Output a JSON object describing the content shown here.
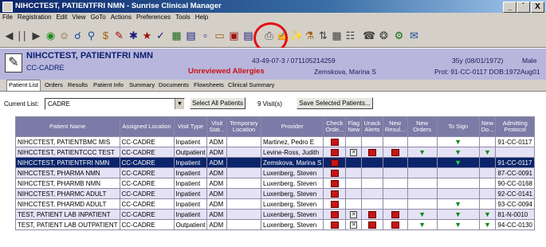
{
  "window": {
    "title": "NIHCCTEST, PATIENTFRI NMN - Sunrise Clinical Manager",
    "min": "_",
    "restore": "´",
    "close": "X"
  },
  "menu": [
    "File",
    "Registration",
    "Edit",
    "View",
    "GoTo",
    "Actions",
    "Preferences",
    "Tools",
    "Help"
  ],
  "toolbar_icons": [
    "back-icon",
    "forward-icon",
    "globe-icon",
    "search-icon",
    "magnifier-icon",
    "money-icon",
    "edit-icon",
    "star-icon",
    "person-icon",
    "check-icon",
    "grid-icon",
    "chart-icon",
    "doc-icon",
    "printer-icon",
    "pen-icon",
    "info-icon",
    "flask-icon",
    "sort-icon",
    "table-icon",
    "network-icon",
    "phone-icon",
    "pill-icon",
    "help-icon"
  ],
  "banner": {
    "patient_name": "NIHCCTEST, PATIENTFRI NMN",
    "location": "CC-CADRE",
    "id": "43-49-07-3 / 071105214259",
    "allergy": "Unreviewed Allergies",
    "provider": "Zemskova, Marina S",
    "age": "35y (08/01/1972)",
    "sex": "Male",
    "protocol": "Prot: 91-CC-0117   DOB:1972Aug01"
  },
  "tabs": [
    "Patient List",
    "Orders",
    "Results",
    "Patient Info",
    "Summary",
    "Documents",
    "Flowsheets",
    "Clinical Summary"
  ],
  "list": {
    "label": "Current List:",
    "value": "CADRE",
    "select_all": "Select All Patients",
    "visits": "9 Visit(s)",
    "save_selected": "Save Selected Patients..."
  },
  "table": {
    "headers": [
      "Patient Name",
      "Assigned Location",
      "Visit Type",
      "Visit Stat...",
      "Temporary Location",
      "Provider",
      "Check Orde...",
      "Flag New",
      "Unack Alerts",
      "New Resul...",
      "New Orders",
      "To Sign",
      "New Do...",
      "Admitting Protocol"
    ],
    "rows": [
      {
        "name": "NIHCCTEST, PATIENTBMC MIS",
        "loc": "CC-CADRE",
        "type": "Inpatient",
        "stat": "ADM",
        "temp": "",
        "prov": "Martinez, Pedro E",
        "check": true,
        "flag": false,
        "unack": false,
        "res": false,
        "ord": false,
        "sign": true,
        "doc": false,
        "proto": "91-CC-0117",
        "style": "r-white"
      },
      {
        "name": "NIHCCTEST, PATIENTCCC TEST",
        "loc": "CC-CADRE",
        "type": "Outpatient",
        "stat": "ADM",
        "temp": "",
        "prov": "Levine-Ross, Judith",
        "check": true,
        "flag": true,
        "unack": true,
        "res": true,
        "ord": true,
        "sign": true,
        "doc": true,
        "proto": "",
        "style": "r-lav"
      },
      {
        "name": "NIHCCTEST, PATIENTFRI NMN",
        "loc": "CC-CADRE",
        "type": "Inpatient",
        "stat": "ADM",
        "temp": "",
        "prov": "Zemskova, Marina S",
        "check": true,
        "flag": false,
        "unack": false,
        "res": false,
        "ord": false,
        "sign": true,
        "doc": false,
        "proto": "91-CC-0117",
        "style": "r-sel"
      },
      {
        "name": "NIHCCTEST, PHARMA NMN",
        "loc": "CC-CADRE",
        "type": "Inpatient",
        "stat": "ADM",
        "temp": "",
        "prov": "Luxenberg, Steven",
        "check": true,
        "flag": false,
        "unack": false,
        "res": false,
        "ord": false,
        "sign": false,
        "doc": false,
        "proto": "87-CC-0091",
        "style": "r-lav"
      },
      {
        "name": "NIHCCTEST, PHARMB NMN",
        "loc": "CC-CADRE",
        "type": "Inpatient",
        "stat": "ADM",
        "temp": "",
        "prov": "Luxenberg, Steven",
        "check": true,
        "flag": false,
        "unack": false,
        "res": false,
        "ord": false,
        "sign": false,
        "doc": false,
        "proto": "90-CC-0168",
        "style": "r-white"
      },
      {
        "name": "NIHCCTEST, PHARMC ADULT",
        "loc": "CC-CADRE",
        "type": "Inpatient",
        "stat": "ADM",
        "temp": "",
        "prov": "Luxenberg, Steven",
        "check": true,
        "flag": false,
        "unack": false,
        "res": false,
        "ord": false,
        "sign": false,
        "doc": false,
        "proto": "92-CC-0141",
        "style": "r-lav"
      },
      {
        "name": "NIHCCTEST, PHARMD ADULT",
        "loc": "CC-CADRE",
        "type": "Inpatient",
        "stat": "ADM",
        "temp": "",
        "prov": "Luxenberg, Steven",
        "check": true,
        "flag": false,
        "unack": false,
        "res": false,
        "ord": false,
        "sign": true,
        "doc": false,
        "proto": "93-CC-0094",
        "style": "r-white"
      },
      {
        "name": "TEST, PATIENT LAB INPATIENT",
        "loc": "CC-CADRE",
        "type": "Inpatient",
        "stat": "ADM",
        "temp": "",
        "prov": "Luxenberg, Steven",
        "check": true,
        "flag": true,
        "unack": true,
        "res": true,
        "ord": true,
        "sign": true,
        "doc": true,
        "proto": "81-N-0010",
        "style": "r-lav"
      },
      {
        "name": "TEST, PATIENT LAB OUTPATIENT",
        "loc": "CC-CADRE",
        "type": "Outpatient",
        "stat": "ADM",
        "temp": "",
        "prov": "Luxenberg, Steven",
        "check": true,
        "flag": true,
        "unack": true,
        "res": true,
        "ord": true,
        "sign": true,
        "doc": true,
        "proto": "94-CC-0130",
        "style": "r-white"
      }
    ]
  }
}
